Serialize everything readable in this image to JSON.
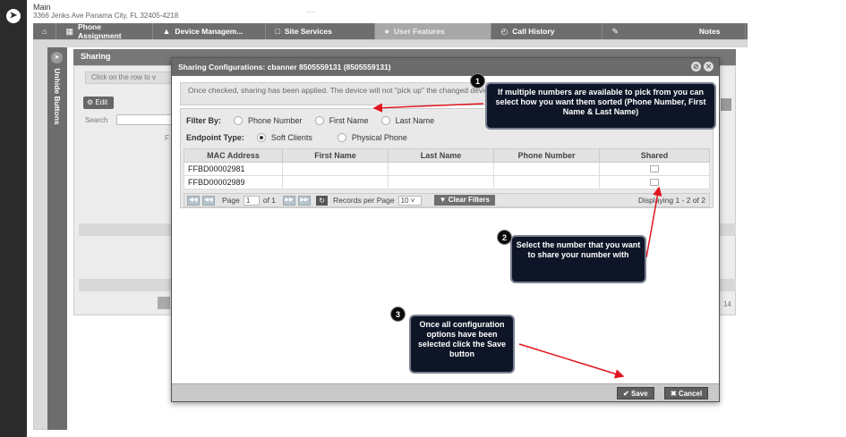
{
  "header": {
    "main_link": "Main",
    "address": "3366 Jenks Ave Panama City, FL 32405-4218",
    "dash": "----"
  },
  "tabs": [
    {
      "label": "",
      "icon": "home-icon"
    },
    {
      "label": "Phone Assignment",
      "icon": "grid-icon"
    },
    {
      "label": "Device Managem...",
      "icon": "bell-icon"
    },
    {
      "label": "Site Services",
      "icon": "building-icon"
    },
    {
      "label": "User Features",
      "icon": "user-icon"
    },
    {
      "label": "Call History",
      "icon": "clock-icon"
    },
    {
      "label": "Notes",
      "icon": "pencil-icon"
    }
  ],
  "side": {
    "toggle_label": "Unhide Buttons"
  },
  "background": {
    "sharing_title": "Sharing",
    "click_hint": "Click on the row to v",
    "edit_label": "Edit",
    "search_label": "Search",
    "f_label": "F",
    "page_fragment": "14"
  },
  "modal": {
    "title": "Sharing Configurations: cbanner 8505559131 (8505559131)",
    "message": "Once checked, sharing has been applied. The device will not \"pick up\" the changed devices.",
    "filter_by_label": "Filter By:",
    "filter_options": [
      "Phone Number",
      "First Name",
      "Last Name"
    ],
    "endpoint_type_label": "Endpoint Type:",
    "endpoint_options": [
      "Soft Clients",
      "Physical Phone"
    ],
    "endpoint_selected": "Soft Clients",
    "columns": [
      "MAC Address",
      "First Name",
      "Last Name",
      "Phone Number",
      "Shared"
    ],
    "rows": [
      {
        "mac": "FFBD00002981",
        "first": "",
        "last": "",
        "phone": "",
        "shared": false
      },
      {
        "mac": "FFBD00002989",
        "first": "",
        "last": "",
        "phone": "",
        "shared": false
      }
    ],
    "pager": {
      "page_label": "Page",
      "page_value": "1",
      "of_label": "of 1",
      "records_label": "Records per Page",
      "records_value": "10",
      "clear_filters": "Clear Filters",
      "displaying": "Displaying 1 - 2 of 2"
    },
    "save_label": "Save",
    "cancel_label": "Cancel"
  },
  "callouts": [
    {
      "number": "1",
      "text": "If multiple numbers are available to pick from you can select how you want them sorted (Phone Number, First Name & Last Name)"
    },
    {
      "number": "2",
      "text": "Select the number that you want to share your number with"
    },
    {
      "number": "3",
      "text": "Once all configuration options have been selected click the Save button"
    }
  ],
  "colors": {
    "accent": "#6b6b6b",
    "callout_bg": "#0e1526",
    "arrow": "#e0141e"
  }
}
